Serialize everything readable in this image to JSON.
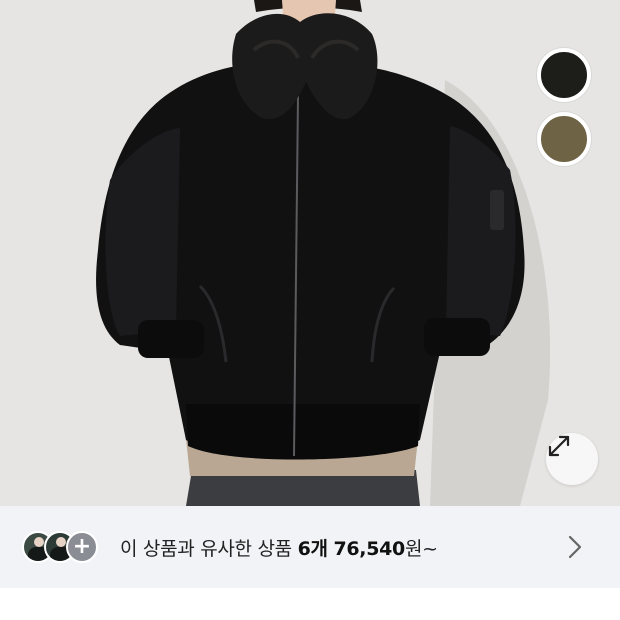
{
  "product": {
    "image_icon": "bomber-jacket-photo",
    "swatches": [
      {
        "color": "#1d1e1a"
      },
      {
        "color": "#6e6345"
      }
    ],
    "zoom_icon": "expand-arrows-icon"
  },
  "similar_products": {
    "prefix": "이 상품과 유사한 상품",
    "count": "6개",
    "price": "76,540",
    "suffix": "원~",
    "more_icon": "chevron-right-icon",
    "thumbnail_plus_icon": "plus-icon"
  }
}
